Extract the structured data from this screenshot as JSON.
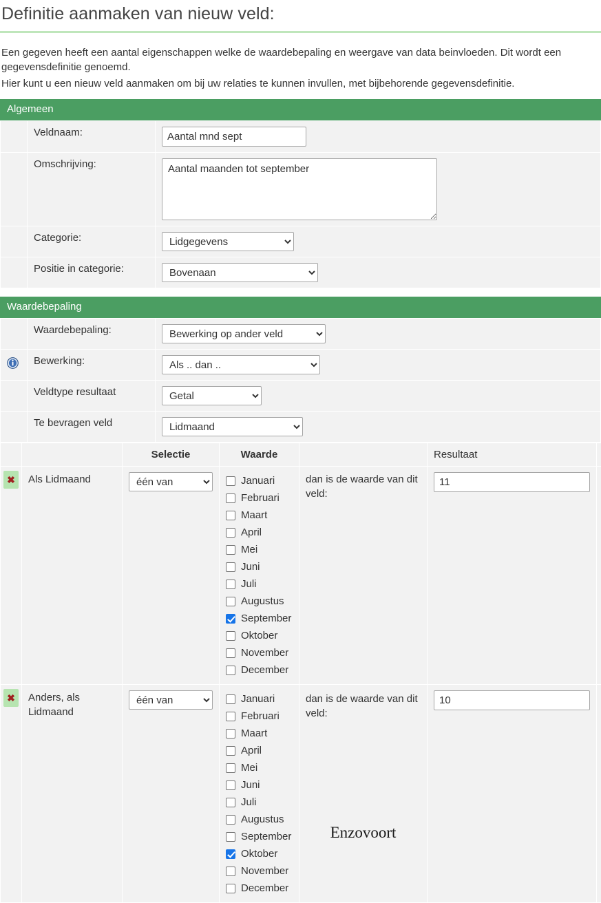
{
  "page": {
    "title": "Definitie aanmaken van nieuw veld:",
    "intro_paragraph_1": "Een gegeven heeft een aantal eigenschappen welke de waardebepaling en weergave van data beinvloeden. Dit wordt een gegevensdefinitie genoemd.",
    "intro_paragraph_2": "Hier kunt u een nieuw veld aanmaken om bij uw relaties te kunnen invullen, met bijbehorende gegevensdefinitie."
  },
  "colors": {
    "section_header_green": "#4b9e62",
    "title_rule_green": "#bfe6bb",
    "cell_grey": "#f2f2f2",
    "checkbox_checked_blue": "#1674e8",
    "delete_button_green": "#b6e4b0",
    "delete_icon_red": "#a02020"
  },
  "algemeen": {
    "header": "Algemeen",
    "veldnaam": {
      "label": "Veldnaam:",
      "value": "Aantal mnd sept",
      "placeholder": ""
    },
    "omschrijving": {
      "label": "Omschrijving:",
      "value": "Aantal maanden tot september",
      "placeholder": ""
    },
    "categorie": {
      "label": "Categorie:",
      "value": "Lidgegevens",
      "options": [
        "Lidgegevens"
      ]
    },
    "positie": {
      "label": "Positie in categorie:",
      "value": "Bovenaan",
      "options": [
        "Bovenaan"
      ]
    }
  },
  "waardebepaling": {
    "header": "Waardebepaling",
    "waardebepaling": {
      "label": "Waardebepaling:",
      "value": "Bewerking op ander veld",
      "options": [
        "Bewerking op ander veld"
      ]
    },
    "bewerking": {
      "label": "Bewerking:",
      "value": "Als .. dan ..",
      "options": [
        "Als .. dan .."
      ],
      "info_icon": "info-icon"
    },
    "veldtype_resultaat": {
      "label": "Veldtype resultaat",
      "value": "Getal",
      "options": [
        "Getal"
      ]
    },
    "te_bevragen_veld": {
      "label": "Te bevragen veld",
      "value": "Lidmaand",
      "options": [
        "Lidmaand"
      ]
    }
  },
  "rules_table": {
    "headers": {
      "delete": "",
      "condition": "",
      "selectie": "Selectie",
      "waarde": "Waarde",
      "then": "",
      "resultaat": "Resultaat"
    },
    "months": [
      "Januari",
      "Februari",
      "Maart",
      "April",
      "Mei",
      "Juni",
      "Juli",
      "Augustus",
      "September",
      "Oktober",
      "November",
      "December"
    ],
    "delete_icon": "close-icon",
    "rows": [
      {
        "condition": "Als Lidmaand",
        "selectie": {
          "value": "één van",
          "options": [
            "één van"
          ]
        },
        "checked_months": [
          "September"
        ],
        "then_text": "dan is de waarde van dit veld:",
        "resultaat": "11"
      },
      {
        "condition": "Anders, als Lidmaand",
        "selectie": {
          "value": "één van",
          "options": [
            "één van"
          ]
        },
        "checked_months": [
          "Oktober"
        ],
        "then_text": "dan is de waarde van dit veld:",
        "resultaat": "10",
        "note": "Enzovoort"
      }
    ]
  }
}
